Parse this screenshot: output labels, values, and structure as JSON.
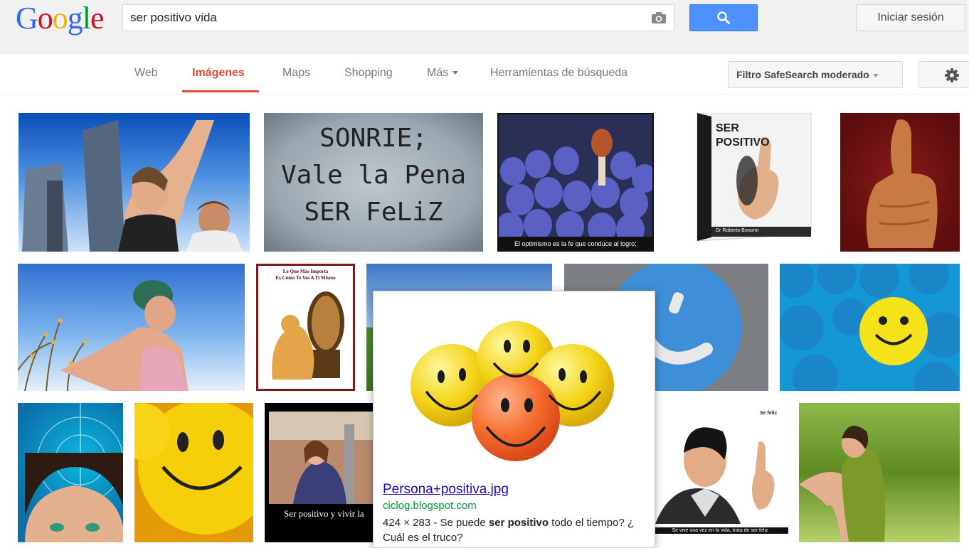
{
  "header": {
    "logo": [
      "G",
      "o",
      "o",
      "g",
      "l",
      "e"
    ],
    "logo_colors": [
      "#3369e8",
      "#d50f25",
      "#eeb211",
      "#3369e8",
      "#009925",
      "#d50f25"
    ],
    "search_value": "ser positivo vida",
    "signin_label": "Iniciar sesión"
  },
  "nav": {
    "tabs": [
      {
        "label": "Web"
      },
      {
        "label": "Imágenes",
        "active": true
      },
      {
        "label": "Maps"
      },
      {
        "label": "Shopping"
      },
      {
        "label": "Más"
      },
      {
        "label": "Herramientas de búsqueda"
      }
    ],
    "safesearch_label": "Filtro SafeSearch moderado"
  },
  "thumbs": {
    "t2_text": [
      "SONRIE;",
      "Vale la Pena",
      "SER FeLiZ"
    ],
    "t3_caption": "El optimismo es la fe que conduce al logro;",
    "t4_title": [
      "SER",
      "POSITIVO"
    ],
    "t4_author": "Dr Roberto Bonomi",
    "t7_title": [
      "Lo Que Más Importa",
      "Es Cómo Te Ves A Ti Mismo"
    ],
    "t13_caption": "Ser positivo y vivir la",
    "t14_label": "Se feliz",
    "t14_caption": "Se vive una vez en la vida, trata de ser feliz"
  },
  "popup": {
    "title": "Persona+positiva.jpg",
    "url": "ciclog.blogspot.com",
    "dims": "424 × 283 - Se puede ",
    "bold": "ser positivo",
    "rest": " todo el tiempo? ¿ Cuál es el truco?"
  },
  "colors": {
    "accent": "#dd4b39",
    "link": "#1a0dab",
    "url": "#009933",
    "button": "#4d90fe"
  }
}
